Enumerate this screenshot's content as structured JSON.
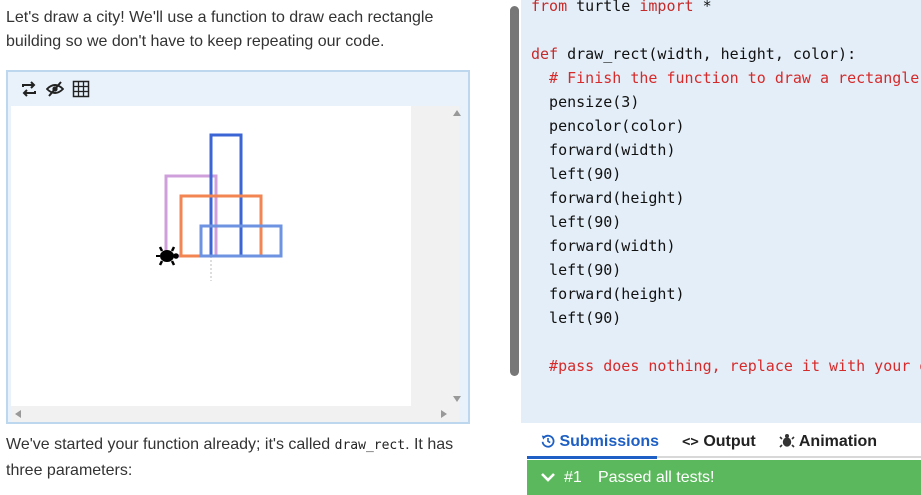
{
  "intro": {
    "line1": "Let's draw a city! We'll use a function to draw each rectangle",
    "line2": "building so we don't have to keep repeating our code."
  },
  "toolbar": {
    "icons": [
      "repeat-icon",
      "hide-icon",
      "grid-icon"
    ]
  },
  "after": {
    "prefix": "We've started your function already; it's called ",
    "code": "draw_rect",
    "suffix": ". It has",
    "line2": "three parameters:"
  },
  "code_lines": [
    {
      "text": "from turtle import *",
      "parts": [
        [
          "kw",
          "from"
        ],
        [
          "",
          " turtle "
        ],
        [
          "kw",
          "import"
        ],
        [
          "",
          " *"
        ]
      ]
    },
    {
      "text": ""
    },
    {
      "parts": [
        [
          "kw",
          "def"
        ],
        [
          "",
          " draw_rect(width, height, color):"
        ]
      ]
    },
    {
      "parts": [
        [
          "cm",
          "  # Finish the function to draw a rectangle:"
        ]
      ]
    },
    {
      "parts": [
        [
          "",
          "  pensize(3)"
        ]
      ]
    },
    {
      "parts": [
        [
          "",
          "  pencolor(color)"
        ]
      ]
    },
    {
      "parts": [
        [
          "",
          "  forward(width)"
        ]
      ]
    },
    {
      "parts": [
        [
          "",
          "  left(90)"
        ]
      ]
    },
    {
      "parts": [
        [
          "",
          "  forward(height)"
        ]
      ]
    },
    {
      "parts": [
        [
          "",
          "  left(90)"
        ]
      ]
    },
    {
      "parts": [
        [
          "",
          "  forward(width)"
        ]
      ]
    },
    {
      "parts": [
        [
          "",
          "  left(90)"
        ]
      ]
    },
    {
      "parts": [
        [
          "",
          "  forward(height)"
        ]
      ]
    },
    {
      "parts": [
        [
          "",
          "  left(90)"
        ]
      ]
    },
    {
      "parts": [
        [
          "",
          ""
        ]
      ]
    },
    {
      "parts": [
        [
          "cm",
          "  #pass does nothing, replace it with your dr"
        ]
      ]
    }
  ],
  "tabs": {
    "submissions": "Submissions",
    "output": "Output",
    "animation": "Animation"
  },
  "result": {
    "number": "#1",
    "message": "Passed all tests!"
  },
  "colors": {
    "pink": "#cf9fdc",
    "blue_tall": "#3b64d4",
    "orange": "#f28552",
    "blue_wide": "#6d93e1",
    "accent": "#1d5fc4",
    "success": "#5cb85c"
  }
}
